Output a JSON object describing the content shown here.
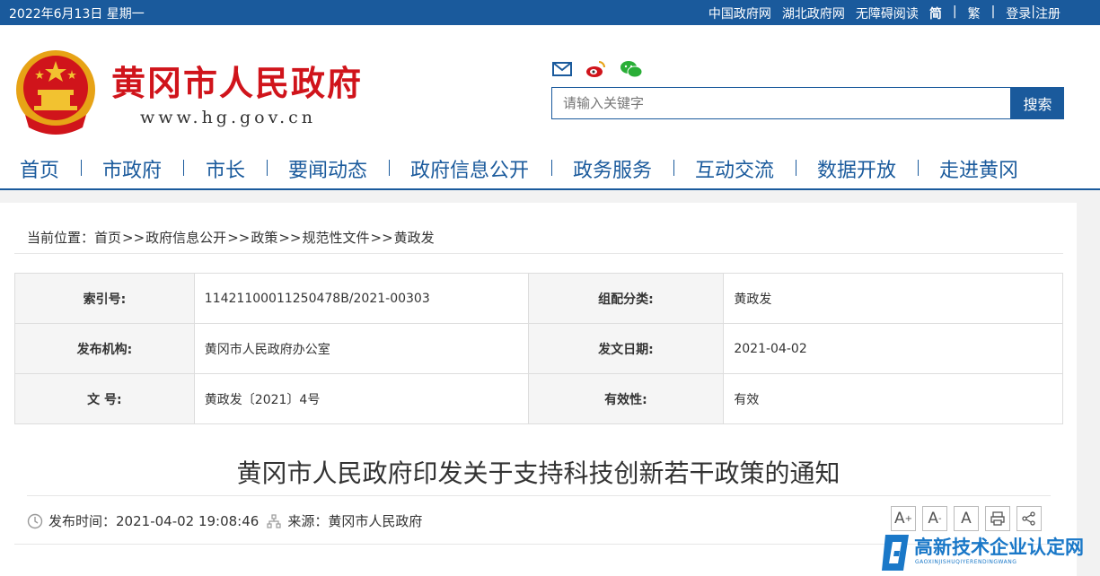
{
  "topbar": {
    "date": "2022年6月13日 星期一",
    "links": [
      "中国政府网",
      "湖北政府网",
      "无障碍阅读"
    ],
    "simplified": "简",
    "sep": "|",
    "traditional": "繁",
    "login": "登录",
    "register": "注册"
  },
  "brand": {
    "title": "黄冈市人民政府",
    "url": "www.hg.gov.cn"
  },
  "social": {
    "icons": [
      "mail-icon",
      "weibo-icon",
      "wechat-icon"
    ]
  },
  "search": {
    "placeholder": "请输入关键字",
    "button": "搜索"
  },
  "nav": {
    "items": [
      "首页",
      "市政府",
      "市长",
      "要闻动态",
      "政府信息公开",
      "政务服务",
      "互动交流",
      "数据开放",
      "走进黄冈"
    ]
  },
  "breadcrumb": {
    "label": "当前位置：",
    "items": [
      "首页",
      "政府信息公开",
      "政策",
      "规范性文件",
      "黄政发"
    ],
    "separator": ">>"
  },
  "meta": {
    "rows": [
      {
        "k1": "索引号:",
        "v1": "11421100011250478B/2021-00303",
        "k2": "组配分类:",
        "v2": "黄政发"
      },
      {
        "k1": "发布机构:",
        "v1": "黄冈市人民政府办公室",
        "k2": "发文日期:",
        "v2": "2021-04-02"
      },
      {
        "k1": "文 号:",
        "v1": "黄政发〔2021〕4号",
        "k2": "有效性:",
        "v2": "有效"
      }
    ]
  },
  "article": {
    "title": "黄冈市人民政府印发关于支持科技创新若干政策的通知",
    "publish_label": "发布时间：",
    "publish_time": "2021-04-02 19:08:46",
    "source_label": "来源：",
    "source": "黄冈市人民政府"
  },
  "tools": {
    "font_large": "A",
    "font_normal": "A",
    "font_reset": "A"
  },
  "watermark": {
    "title": "高新技术企业认定网",
    "subtitle": "GAOXINJISHUQIYERENDINGWANG"
  },
  "colors": {
    "primary": "#1a5a9c",
    "brand_red": "#d0141b"
  }
}
